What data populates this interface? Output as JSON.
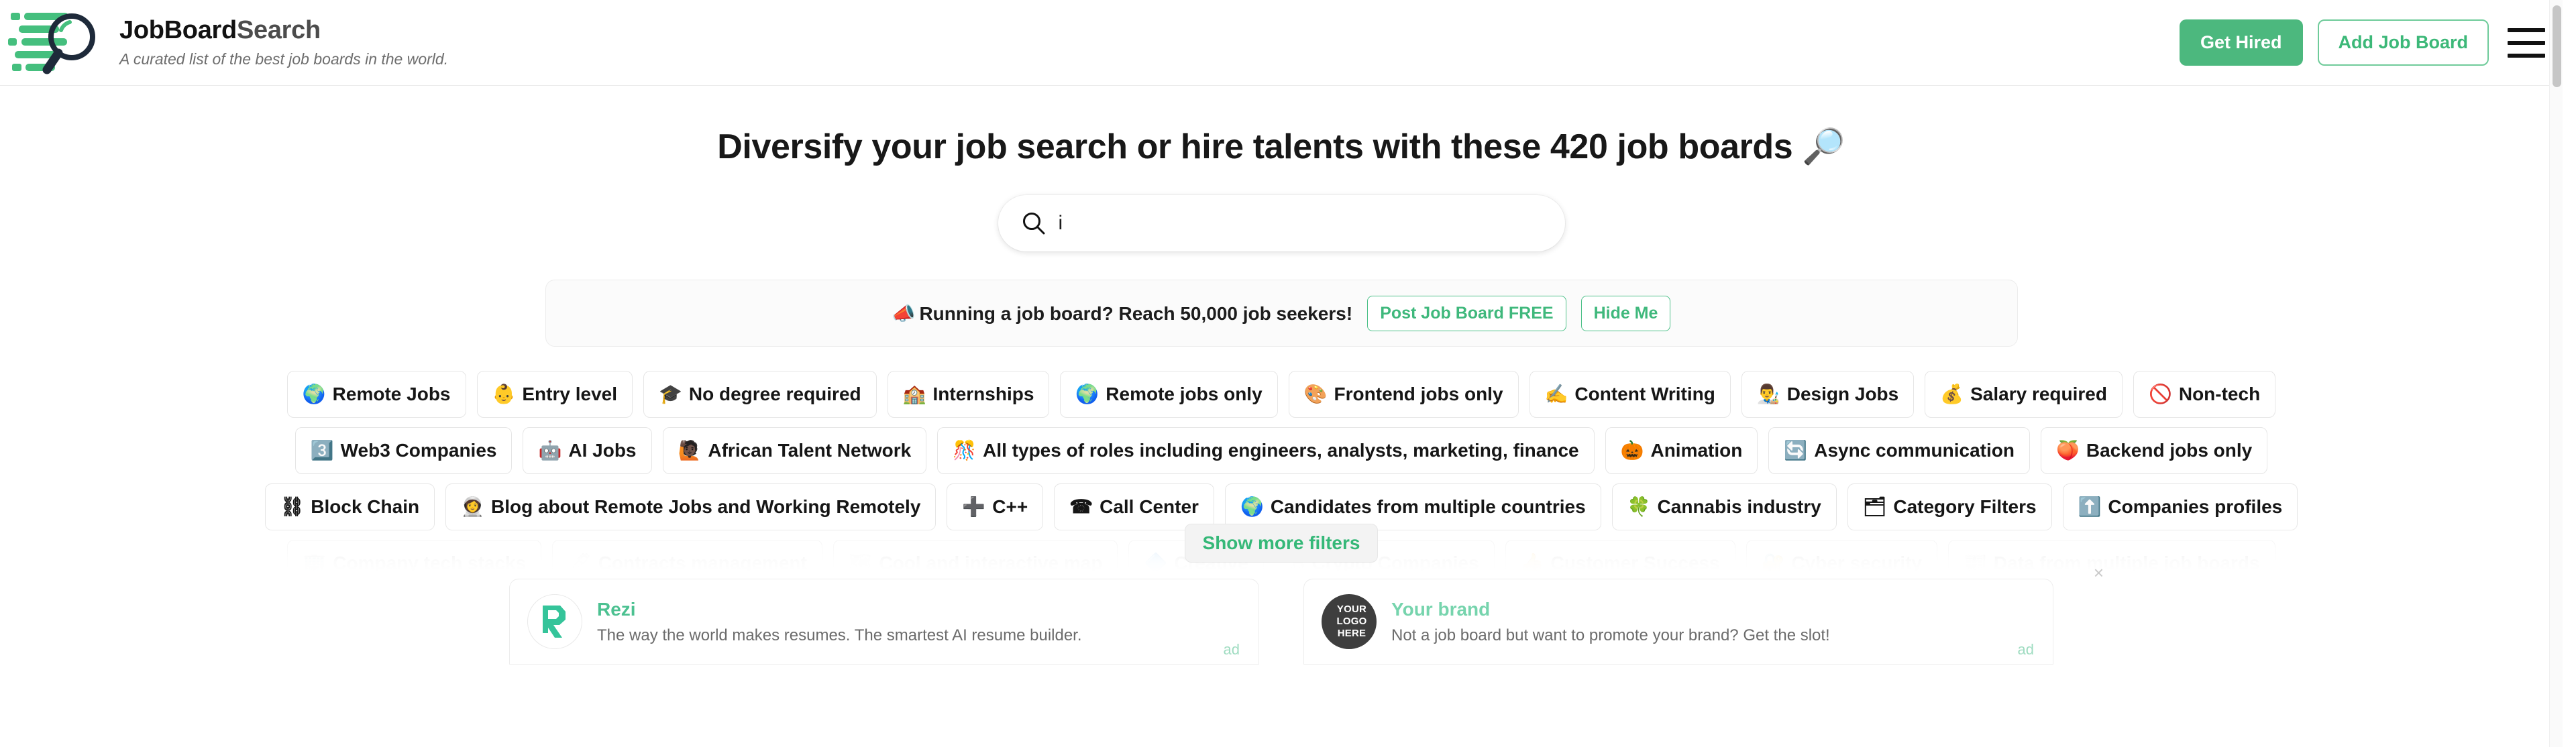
{
  "header": {
    "brand_title_bold": "JobBoard",
    "brand_title_light": "Search",
    "tagline": "A curated list of the best job boards in the world.",
    "get_hired_label": "Get Hired",
    "add_job_board_label": "Add Job Board",
    "menu_icon": "hamburger-menu-icon",
    "accent_color": "#4cb87e"
  },
  "hero": {
    "title": "Diversify your job search or hire talents with these 420 job boards 🔎",
    "job_board_count": 420
  },
  "search": {
    "value": "i",
    "icon": "search-icon"
  },
  "promo": {
    "emoji": "📣",
    "text": "Running a job board? Reach 50,000 job seekers!",
    "primary_label": "Post Job Board FREE",
    "dismiss_label": "Hide Me",
    "reach": "50,000"
  },
  "filters": {
    "show_more_label": "Show more filters",
    "rows": [
      {
        "faded": false,
        "tags": [
          {
            "emoji": "🌍",
            "label": "Remote Jobs"
          },
          {
            "emoji": "👶",
            "label": "Entry level"
          },
          {
            "emoji": "🎓",
            "label": "No degree required"
          },
          {
            "emoji": "🏫",
            "label": "Internships"
          },
          {
            "emoji": "🌍",
            "label": "Remote jobs only"
          },
          {
            "emoji": "🎨",
            "label": "Frontend jobs only"
          },
          {
            "emoji": "✍️",
            "label": "Content Writing"
          },
          {
            "emoji": "👨‍🎨",
            "label": "Design Jobs"
          },
          {
            "emoji": "💰",
            "label": "Salary required"
          },
          {
            "emoji": "🚫",
            "label": "Non-tech"
          }
        ]
      },
      {
        "faded": false,
        "tags": [
          {
            "emoji": "3️⃣",
            "label": "Web3 Companies"
          },
          {
            "emoji": "🤖",
            "label": "AI Jobs"
          },
          {
            "emoji": "🙋🏿",
            "label": "African Talent Network"
          },
          {
            "emoji": "🎊",
            "label": "All types of roles including engineers, analysts, marketing, finance"
          },
          {
            "emoji": "🎃",
            "label": "Animation"
          },
          {
            "emoji": "🔄",
            "label": "Async communication"
          },
          {
            "emoji": "🍑",
            "label": "Backend jobs only"
          }
        ]
      },
      {
        "faded": false,
        "tags": [
          {
            "emoji": "⛓",
            "label": "Block Chain"
          },
          {
            "emoji": "👩‍🚀",
            "label": "Blog about Remote Jobs and Working Remotely"
          },
          {
            "emoji": "➕",
            "label": "C++"
          },
          {
            "emoji": "☎",
            "label": "Call Center"
          },
          {
            "emoji": "🌍",
            "label": "Candidates from multiple countries"
          },
          {
            "emoji": "🍀",
            "label": "Cannabis industry"
          },
          {
            "emoji": "🗂",
            "label": "Category Filters"
          },
          {
            "emoji": "⬆️",
            "label": "Companies profiles"
          }
        ]
      },
      {
        "faded": true,
        "tags": [
          {
            "emoji": "🏢",
            "label": "Company tech stacks"
          },
          {
            "emoji": "🖊",
            "label": "Contracts management"
          },
          {
            "emoji": "🗺",
            "label": "Cool and interactive map"
          },
          {
            "emoji": "🔷",
            "label": "Creative"
          },
          {
            "emoji": "₿",
            "label": "Crypto Companies"
          },
          {
            "emoji": "👍",
            "label": "Customer Success"
          },
          {
            "emoji": "🔐",
            "label": "Cyber security"
          },
          {
            "emoji": "📰",
            "label": "Data from multiple job boards"
          }
        ]
      }
    ]
  },
  "ads": {
    "close_label": "×",
    "items": [
      {
        "logo_type": "rezi-logo",
        "logo_text": "R",
        "title": "Rezi",
        "description": "The way the world makes resumes. The smartest AI resume builder.",
        "tag": "ad"
      },
      {
        "logo_type": "your-logo-here-badge",
        "logo_text": "YOUR\nLOGO\nHERE",
        "logo_line1": "YOUR",
        "logo_line2": "LOGO",
        "logo_line3": "HERE",
        "title": "Your brand",
        "description": "Not a job board but want to promote your brand? Get the slot!",
        "tag": "ad"
      }
    ]
  }
}
